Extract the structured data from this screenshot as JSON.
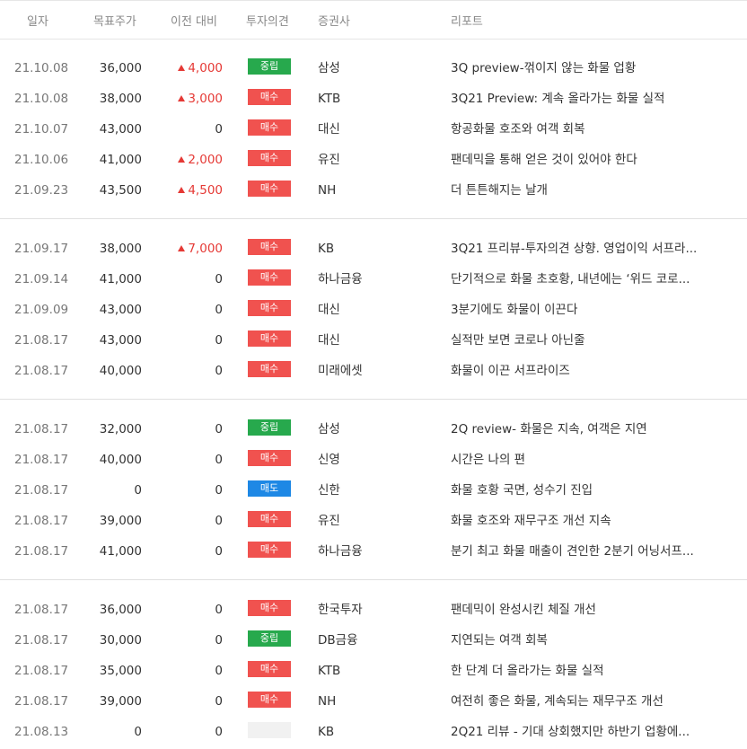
{
  "header": {
    "date": "일자",
    "target_price": "목표주가",
    "change": "이전 대비",
    "opinion": "투자의견",
    "broker": "증권사",
    "report": "리포트"
  },
  "colors": {
    "buy": "#f0524f",
    "hold": "#27a94d",
    "sell": "#1e88e5",
    "up": "#e53935"
  },
  "groups": [
    [
      {
        "date": "21.10.08",
        "target": "36,000",
        "change": "4,000",
        "dir": "up",
        "opinion": "중립",
        "opinion_type": "hold",
        "broker": "삼성",
        "report": "3Q preview-꺾이지 않는 화물 업황"
      },
      {
        "date": "21.10.08",
        "target": "38,000",
        "change": "3,000",
        "dir": "up",
        "opinion": "매수",
        "opinion_type": "buy",
        "broker": "KTB",
        "report": "3Q21 Preview: 계속 올라가는 화물 실적"
      },
      {
        "date": "21.10.07",
        "target": "43,000",
        "change": "0",
        "dir": "none",
        "opinion": "매수",
        "opinion_type": "buy",
        "broker": "대신",
        "report": "항공화물 호조와 여객 회복"
      },
      {
        "date": "21.10.06",
        "target": "41,000",
        "change": "2,000",
        "dir": "up",
        "opinion": "매수",
        "opinion_type": "buy",
        "broker": "유진",
        "report": "팬데믹을 통해 얻은 것이 있어야 한다"
      },
      {
        "date": "21.09.23",
        "target": "43,500",
        "change": "4,500",
        "dir": "up",
        "opinion": "매수",
        "opinion_type": "buy",
        "broker": "NH",
        "report": "더 튼튼해지는 날개"
      }
    ],
    [
      {
        "date": "21.09.17",
        "target": "38,000",
        "change": "7,000",
        "dir": "up",
        "opinion": "매수",
        "opinion_type": "buy",
        "broker": "KB",
        "report": "3Q21 프리뷰-투자의견 상향. 영업이익 서프라..."
      },
      {
        "date": "21.09.14",
        "target": "41,000",
        "change": "0",
        "dir": "none",
        "opinion": "매수",
        "opinion_type": "buy",
        "broker": "하나금융",
        "report": "단기적으로 화물 초호황, 내년에는 ‘위드 코로..."
      },
      {
        "date": "21.09.09",
        "target": "43,000",
        "change": "0",
        "dir": "none",
        "opinion": "매수",
        "opinion_type": "buy",
        "broker": "대신",
        "report": "3분기에도 화물이 이끈다"
      },
      {
        "date": "21.08.17",
        "target": "43,000",
        "change": "0",
        "dir": "none",
        "opinion": "매수",
        "opinion_type": "buy",
        "broker": "대신",
        "report": "실적만 보면 코로나 아닌줄"
      },
      {
        "date": "21.08.17",
        "target": "40,000",
        "change": "0",
        "dir": "none",
        "opinion": "매수",
        "opinion_type": "buy",
        "broker": "미래에셋",
        "report": "화물이 이끈 서프라이즈"
      }
    ],
    [
      {
        "date": "21.08.17",
        "target": "32,000",
        "change": "0",
        "dir": "none",
        "opinion": "중립",
        "opinion_type": "hold",
        "broker": "삼성",
        "report": "2Q review- 화물은 지속, 여객은 지연"
      },
      {
        "date": "21.08.17",
        "target": "40,000",
        "change": "0",
        "dir": "none",
        "opinion": "매수",
        "opinion_type": "buy",
        "broker": "신영",
        "report": "시간은 나의 편"
      },
      {
        "date": "21.08.17",
        "target": "0",
        "change": "0",
        "dir": "none",
        "opinion": "매도",
        "opinion_type": "sell",
        "broker": "신한",
        "report": "화물 호황 국면, 성수기 진입"
      },
      {
        "date": "21.08.17",
        "target": "39,000",
        "change": "0",
        "dir": "none",
        "opinion": "매수",
        "opinion_type": "buy",
        "broker": "유진",
        "report": "화물 호조와 재무구조 개선 지속"
      },
      {
        "date": "21.08.17",
        "target": "41,000",
        "change": "0",
        "dir": "none",
        "opinion": "매수",
        "opinion_type": "buy",
        "broker": "하나금융",
        "report": "분기 최고 화물 매출이 견인한 2분기 어닝서프..."
      }
    ],
    [
      {
        "date": "21.08.17",
        "target": "36,000",
        "change": "0",
        "dir": "none",
        "opinion": "매수",
        "opinion_type": "buy",
        "broker": "한국투자",
        "report": "팬데믹이 완성시킨 체질 개선"
      },
      {
        "date": "21.08.17",
        "target": "30,000",
        "change": "0",
        "dir": "none",
        "opinion": "중립",
        "opinion_type": "hold",
        "broker": "DB금융",
        "report": "지연되는 여객 회복"
      },
      {
        "date": "21.08.17",
        "target": "35,000",
        "change": "0",
        "dir": "none",
        "opinion": "매수",
        "opinion_type": "buy",
        "broker": "KTB",
        "report": "한 단계 더 올라가는 화물 실적"
      },
      {
        "date": "21.08.17",
        "target": "39,000",
        "change": "0",
        "dir": "none",
        "opinion": "매수",
        "opinion_type": "buy",
        "broker": "NH",
        "report": "여전히 좋은 화물, 계속되는 재무구조 개선"
      },
      {
        "date": "21.08.13",
        "target": "0",
        "change": "0",
        "dir": "none",
        "opinion": "",
        "opinion_type": "none",
        "broker": "KB",
        "report": "2Q21 리뷰 - 기대 상회했지만 하반기 업황에..."
      }
    ]
  ]
}
